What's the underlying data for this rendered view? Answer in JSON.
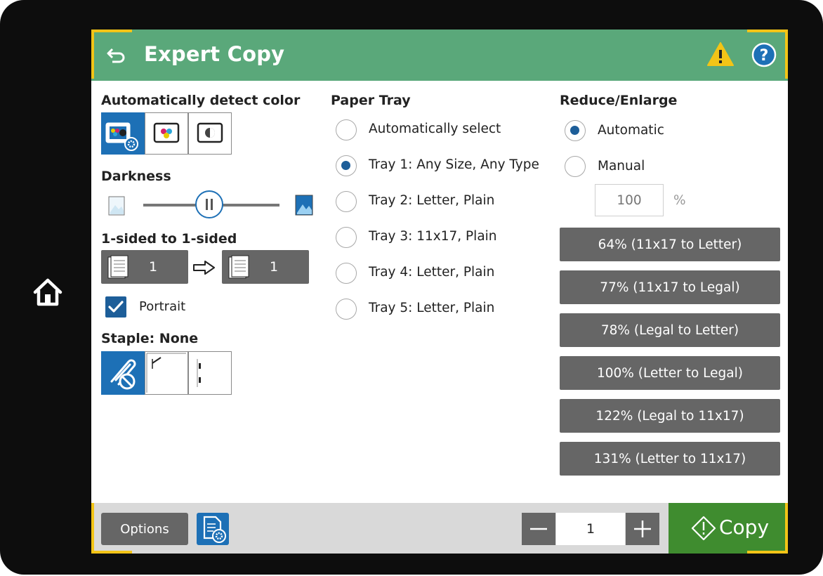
{
  "header": {
    "title": "Expert Copy"
  },
  "color_mode": {
    "label": "Automatically detect color",
    "options": [
      "auto-color",
      "color",
      "grayscale"
    ],
    "selected": "auto-color"
  },
  "darkness": {
    "label": "Darkness",
    "value": 0.5
  },
  "sides": {
    "label": "1-sided to 1-sided",
    "source": "1",
    "dest": "1"
  },
  "portrait": {
    "label": "Portrait",
    "checked": true
  },
  "staple": {
    "label": "Staple: None"
  },
  "paper_tray": {
    "label": "Paper Tray",
    "options": [
      "Automatically select",
      "Tray 1: Any Size, Any Type",
      "Tray 2: Letter, Plain",
      "Tray 3: 11x17, Plain",
      "Tray 4: Letter, Plain",
      "Tray 5: Letter, Plain"
    ],
    "selected": "Tray 1: Any Size, Any Type"
  },
  "reduce_enlarge": {
    "label": "Reduce/Enlarge",
    "automatic": "Automatic",
    "manual": "Manual",
    "selected": "Automatic",
    "percent_placeholder": "100",
    "percent_unit": "%",
    "presets": [
      "64% (11x17 to Letter)",
      "77% (11x17 to Legal)",
      "78% (Legal to Letter)",
      "100% (Letter to Legal)",
      "122% (Legal to 11x17)",
      "131% (Letter to 11x17)"
    ]
  },
  "footer": {
    "options_label": "Options",
    "copies": "1",
    "copy_label": "Copy"
  },
  "colors": {
    "header": "#5aa87a",
    "accent_blue": "#1d70b6",
    "copy_green": "#3f8c2f",
    "gray_button": "#666666",
    "warning_yellow": "#f2c417"
  }
}
